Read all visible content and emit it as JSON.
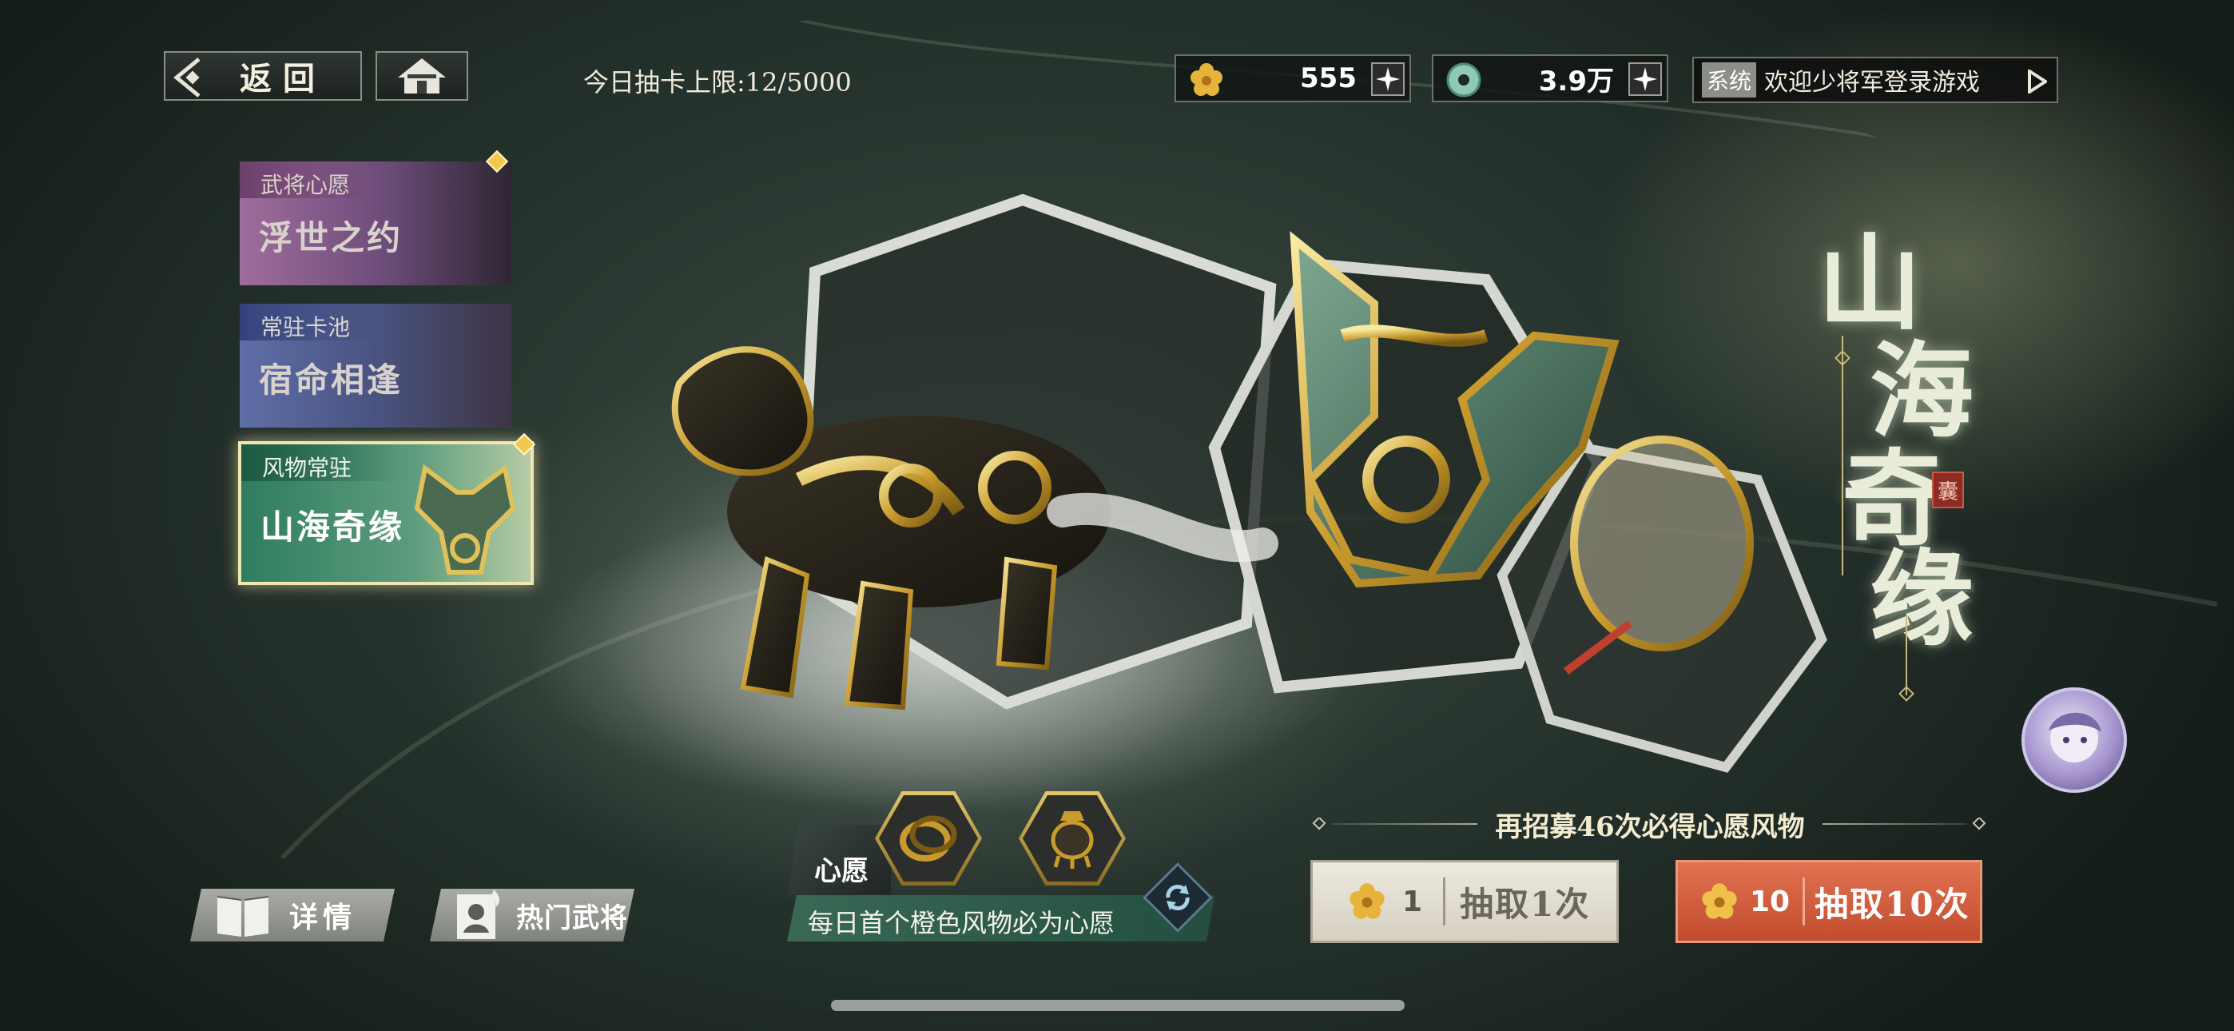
{
  "top_bar": {
    "back_label": "返回",
    "daily_limit_label": "今日抽卡上限:12/5000",
    "currencies": [
      {
        "icon": "gold-flower-icon",
        "value": "555"
      },
      {
        "icon": "jade-coin-icon",
        "value": "3.9万"
      }
    ],
    "notice": {
      "tag": "系统",
      "text": "欢迎少将军登录游戏"
    }
  },
  "banners": [
    {
      "small": "武将心愿",
      "big": "浮世之约",
      "badge": true,
      "selected": false
    },
    {
      "small": "常驻卡池",
      "big": "宿命相逢",
      "badge": false,
      "selected": false
    },
    {
      "small": "风物常驻",
      "big": "山海奇缘",
      "badge": true,
      "selected": true
    }
  ],
  "title": [
    "山",
    "海",
    "奇",
    "缘"
  ],
  "seal_char": "囊",
  "bottom": {
    "details_label": "详情",
    "popular_label": "热门武将",
    "wish_label": "心愿",
    "wish_desc": "每日首个橙色风物必为心愿",
    "pity_text": "再招募46次必得心愿风物",
    "draw_one": {
      "cost": "1",
      "label": "抽取1次"
    },
    "draw_ten": {
      "cost": "10",
      "label": "抽取10次"
    }
  },
  "colors": {
    "accent_orange": "#cf5a38",
    "gold": "#d9b24a",
    "jade": "#3f8a6e",
    "badge_diamond": "#f3c94b"
  }
}
